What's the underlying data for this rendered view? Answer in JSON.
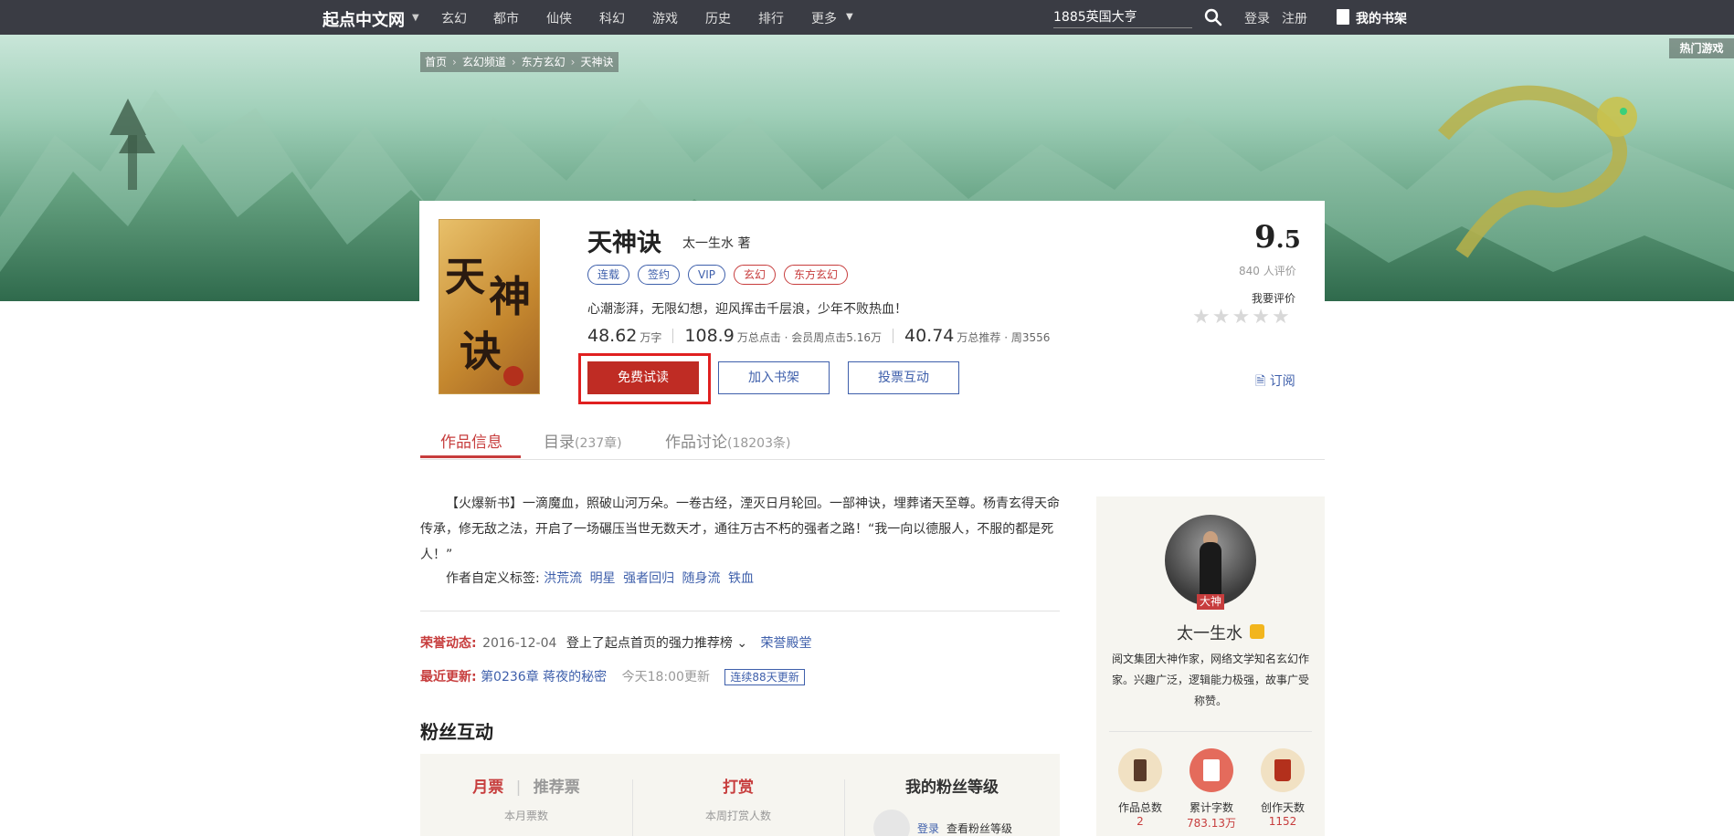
{
  "nav": {
    "brand": "起点中文网",
    "links": [
      "玄幻",
      "都市",
      "仙侠",
      "科幻",
      "游戏",
      "历史",
      "排行",
      "更多"
    ],
    "search_value": "1885英国大亨",
    "login": "登录",
    "register": "注册",
    "bookshelf": "我的书架"
  },
  "banner": {
    "hot_game": "热门游戏",
    "breadcrumb": [
      "首页",
      "玄幻频道",
      "东方玄幻",
      "天神诀"
    ]
  },
  "book": {
    "title": "天神诀",
    "author": "太一生水 著",
    "tags": [
      "连载",
      "签约",
      "VIP",
      "玄幻",
      "东方玄幻"
    ],
    "intro": "心潮澎湃，无限幻想，迎风挥击千层浪，少年不败热血！",
    "words": "48.62",
    "words_unit": "万字",
    "clicks": "108.9",
    "clicks_unit": "万总点击 · 会员周点击5.16万",
    "recommends": "40.74",
    "recommends_unit": "万总推荐 · 周3556",
    "read_button": "免费试读",
    "shelf_button": "加入书架",
    "vote_button": "投票互动",
    "score_int": "9",
    "score_dec": ".5",
    "score_count": "840 人评价",
    "my_rate": "我要评价",
    "subscribe": "订阅"
  },
  "tabs": {
    "info": "作品信息",
    "catalog": "目录",
    "catalog_count": "(237章)",
    "discuss": "作品讨论",
    "discuss_count": "(18203条)"
  },
  "detail": {
    "description": "【火爆新书】一滴魔血，照破山河万朵。一卷古经，湮灭日月轮回。一部神诀，埋葬诸天至尊。杨青玄得天命传承，修无敌之法，开启了一场碾压当世无数天才，通往万古不朽的强者之路！“我一向以德服人，不服的都是死人！”",
    "custom_tags_label": "作者自定义标签:",
    "custom_tags": [
      "洪荒流",
      "明星",
      "强者回归",
      "随身流",
      "铁血"
    ],
    "honor_label": "荣誉动态:",
    "honor_date": "2016-12-04",
    "honor_text": "登上了起点首页的强力推荐榜",
    "honor_link": "荣誉殿堂",
    "update_label": "最近更新:",
    "update_chapter": "第0236章 蒋夜的秘密",
    "update_time": "今天18:00更新",
    "update_badge": "连续88天更新"
  },
  "fans": {
    "title": "粉丝互动",
    "monthly": "月票",
    "recommend": "推荐票",
    "monthly_sub": "本月票数",
    "reward": "打赏",
    "reward_sub": "本周打赏人数",
    "level_title": "我的粉丝等级",
    "login": "登录",
    "level_text": "查看粉丝等级"
  },
  "author_panel": {
    "badge": "大神",
    "name": "太一生水",
    "desc": "阅文集团大神作家，网络文学知名玄幻作家。兴趣广泛，逻辑能力极强，故事广受称赞。",
    "stats": [
      {
        "label": "作品总数",
        "value": "2"
      },
      {
        "label": "累计字数",
        "value": "783.13万"
      },
      {
        "label": "创作天数",
        "value": "1152"
      }
    ]
  },
  "colors": {
    "nav_bg": "#3a3c44",
    "accent_red": "#bf2c24",
    "link_blue": "#3e5fab",
    "highlight": "#e02020"
  }
}
